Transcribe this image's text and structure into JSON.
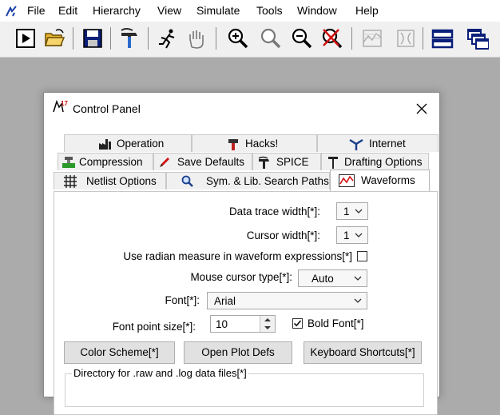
{
  "menubar": {
    "items": [
      {
        "id": "file",
        "label": "File"
      },
      {
        "id": "edit",
        "label": "Edit"
      },
      {
        "id": "hierarchy",
        "label": "Hierarchy"
      },
      {
        "id": "view",
        "label": "View"
      },
      {
        "id": "simulate",
        "label": "Simulate"
      },
      {
        "id": "tools",
        "label": "Tools"
      },
      {
        "id": "window",
        "label": "Window"
      },
      {
        "id": "help",
        "label": "Help"
      }
    ]
  },
  "toolbar": {
    "buttons": [
      "run-icon",
      "open-folder-icon",
      "save-icon",
      "hammer-icon",
      "running-man-icon",
      "hand-icon",
      "zoom-in-icon",
      "zoom-area-icon",
      "zoom-out-icon",
      "zoom-cancel-icon",
      "autorange-icon",
      "autorange-alt-icon",
      "tile-horizontal-icon",
      "cascade-icon"
    ]
  },
  "dialog": {
    "title": "Control Panel",
    "tabs": {
      "row1": [
        {
          "id": "operation",
          "label": "Operation"
        },
        {
          "id": "hacks",
          "label": "Hacks!"
        },
        {
          "id": "internet",
          "label": "Internet"
        }
      ],
      "row2": [
        {
          "id": "compression",
          "label": "Compression"
        },
        {
          "id": "save-defaults",
          "label": "Save Defaults"
        },
        {
          "id": "spice",
          "label": "SPICE"
        },
        {
          "id": "drafting-options",
          "label": "Drafting Options"
        }
      ],
      "row3": [
        {
          "id": "netlist-options",
          "label": "Netlist Options"
        },
        {
          "id": "sym-lib-paths",
          "label": "Sym. & Lib. Search Paths"
        },
        {
          "id": "waveforms",
          "label": "Waveforms"
        }
      ]
    },
    "waveforms": {
      "data_trace_width_label": "Data trace width[*]:",
      "data_trace_width_value": "1",
      "cursor_width_label": "Cursor width[*]:",
      "cursor_width_value": "1",
      "radian_label": "Use radian measure in waveform expressions[*]",
      "mouse_cursor_label": "Mouse cursor type[*]:",
      "mouse_cursor_value": "Auto",
      "font_label": "Font[*]:",
      "font_value": "Arial",
      "font_size_label": "Font point size[*]:",
      "font_size_value": "10",
      "bold_font_label": "Bold Font[*]",
      "bold_font_checked": true,
      "color_scheme_button": "Color Scheme[*]",
      "open_plot_defs_button": "Open Plot Defs",
      "keyboard_shortcuts_button": "Keyboard Shortcuts[*]",
      "directory_group_title": "Directory for .raw and .log data files[*]"
    }
  }
}
